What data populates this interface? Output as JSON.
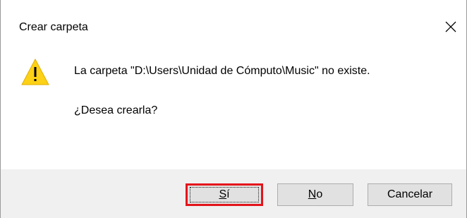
{
  "dialog": {
    "title": "Crear carpeta",
    "close_icon": "close-icon",
    "warning_icon": "warning-triangle-icon",
    "message": "La carpeta \"D:\\Users\\Unidad de Cómputo\\Music\" no existe.",
    "question": "¿Desea crearla?"
  },
  "buttons": {
    "yes": {
      "mnemonic": "S",
      "rest": "í"
    },
    "no": {
      "mnemonic": "N",
      "rest": "o"
    },
    "cancel_label": "Cancelar"
  },
  "colors": {
    "highlight": "#e4141b",
    "warning": "#fcd116",
    "footer_bg": "#f0f0f0"
  }
}
